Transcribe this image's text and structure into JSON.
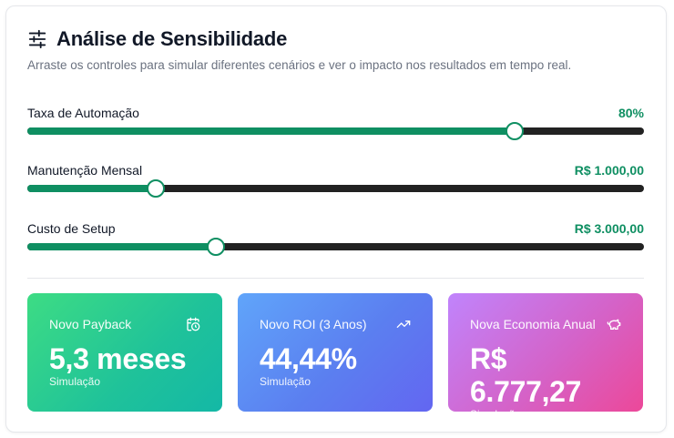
{
  "header": {
    "title": "Análise de Sensibilidade",
    "subtitle": "Arraste os controles para simular diferentes cenários e ver o impacto nos resultados em tempo real.",
    "icon": "sliders-icon"
  },
  "sliders": [
    {
      "label": "Taxa de Automação",
      "value": "80%",
      "level": 0.79
    },
    {
      "label": "Manutenção Mensal",
      "value": "R$ 1.000,00",
      "level": 0.209
    },
    {
      "label": "Custo de Setup",
      "value": "R$ 3.000,00",
      "level": 0.306
    }
  ],
  "metrics": [
    {
      "label": "Novo Payback",
      "value": "5,3 meses",
      "sub": "Simulação",
      "icon": "calendar-clock-icon"
    },
    {
      "label": "Novo ROI (3 Anos)",
      "value": "44,44%",
      "sub": "Simulação",
      "icon": "trending-up-icon"
    },
    {
      "label": "Nova Economia Anual",
      "value": "R$ 6.777,27",
      "sub": "Simulação",
      "icon": "piggy-bank-icon"
    }
  ],
  "colors": {
    "accent": "#0f8f62",
    "track": "#222222"
  }
}
